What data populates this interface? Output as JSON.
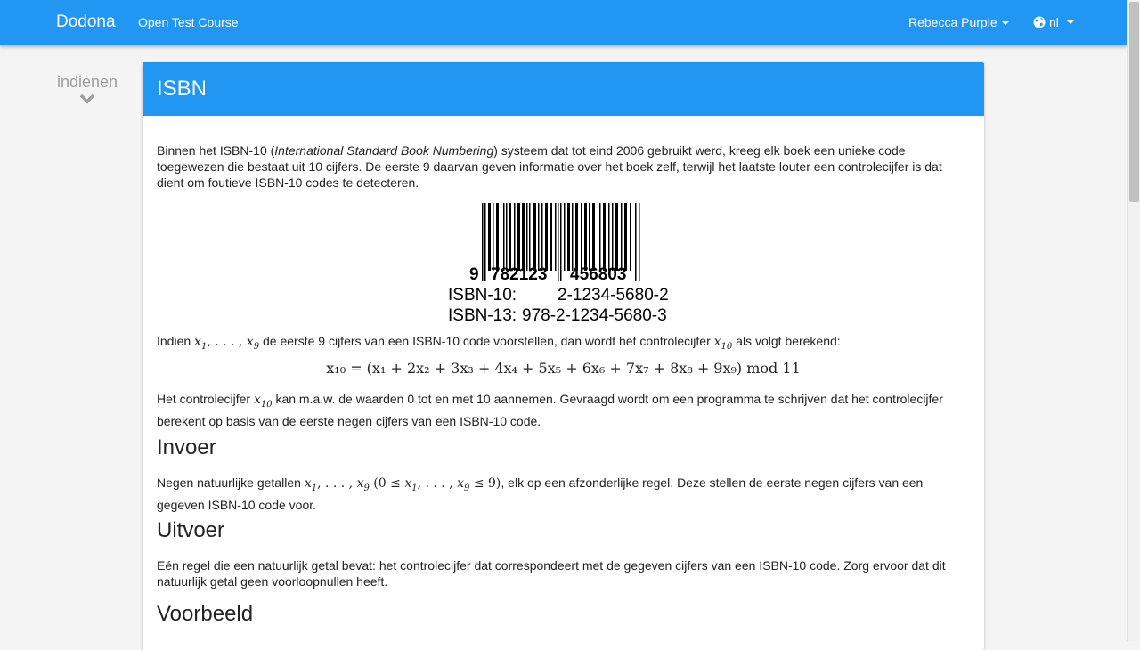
{
  "navbar": {
    "brand": "Dodona",
    "course": "Open Test Course",
    "user": "Rebecca Purple",
    "language": "nl"
  },
  "sidebar": {
    "submit_label": "indienen"
  },
  "exercise": {
    "title": "ISBN",
    "intro_1": "Binnen het ISBN-10 (",
    "intro_italic": "International Standard Book Numbering",
    "intro_2": ") systeem dat tot eind 2006 gebruikt werd, kreeg elk boek een unieke code toegewezen die bestaat uit 10 cijfers. De eerste 9 daarvan geven informatie over het boek zelf, terwijl het laatste louter een controlecijfer is dat dient om foutieve ISBN-10 codes te detecteren.",
    "barcode": {
      "digits_left": "9",
      "digits_mid": "782123",
      "digits_right": "456803",
      "isbn10_label": "ISBN-10:",
      "isbn10_value": "2-1234-5680-2",
      "isbn13_label": "ISBN-13:",
      "isbn13_value": "978-2-1234-5680-3"
    },
    "formula_intro_1": "Indien ",
    "formula_intro_2": " de eerste 9 cijfers van een ISBN-10 code voorstellen, dan wordt het controlecijfer ",
    "formula_intro_3": " als volgt berekend:",
    "formula": "x₁₀ = (x₁ + 2x₂ + 3x₃ + 4x₄ + 5x₅ + 6x₆ + 7x₇ + 8x₈ + 9x₉)  mod  11",
    "after_formula_1": "Het controlecijfer ",
    "after_formula_2": " kan m.a.w. de waarden 0 tot en met 10 aannemen. Gevraagd wordt om een programma te schrijven dat het controlecijfer berekent op basis van de eerste negen cijfers van een ISBN-10 code.",
    "input_heading": "Invoer",
    "input_text_1": "Negen natuurlijke getallen ",
    "input_text_2": ", elk op een afzonderlijke regel. Deze stellen de eerste negen cijfers van een gegeven ISBN-10 code voor.",
    "output_heading": "Uitvoer",
    "output_text": "Eén regel die een natuurlijk getal bevat: het controlecijfer dat correspondeert met de gegeven cijfers van een ISBN-10 code. Zorg ervoor dat dit natuurlijk getal geen voorloopnullen heeft.",
    "example_heading": "Voorbeeld"
  },
  "colors": {
    "primary": "#2196f3",
    "background": "#f4f4f4"
  }
}
